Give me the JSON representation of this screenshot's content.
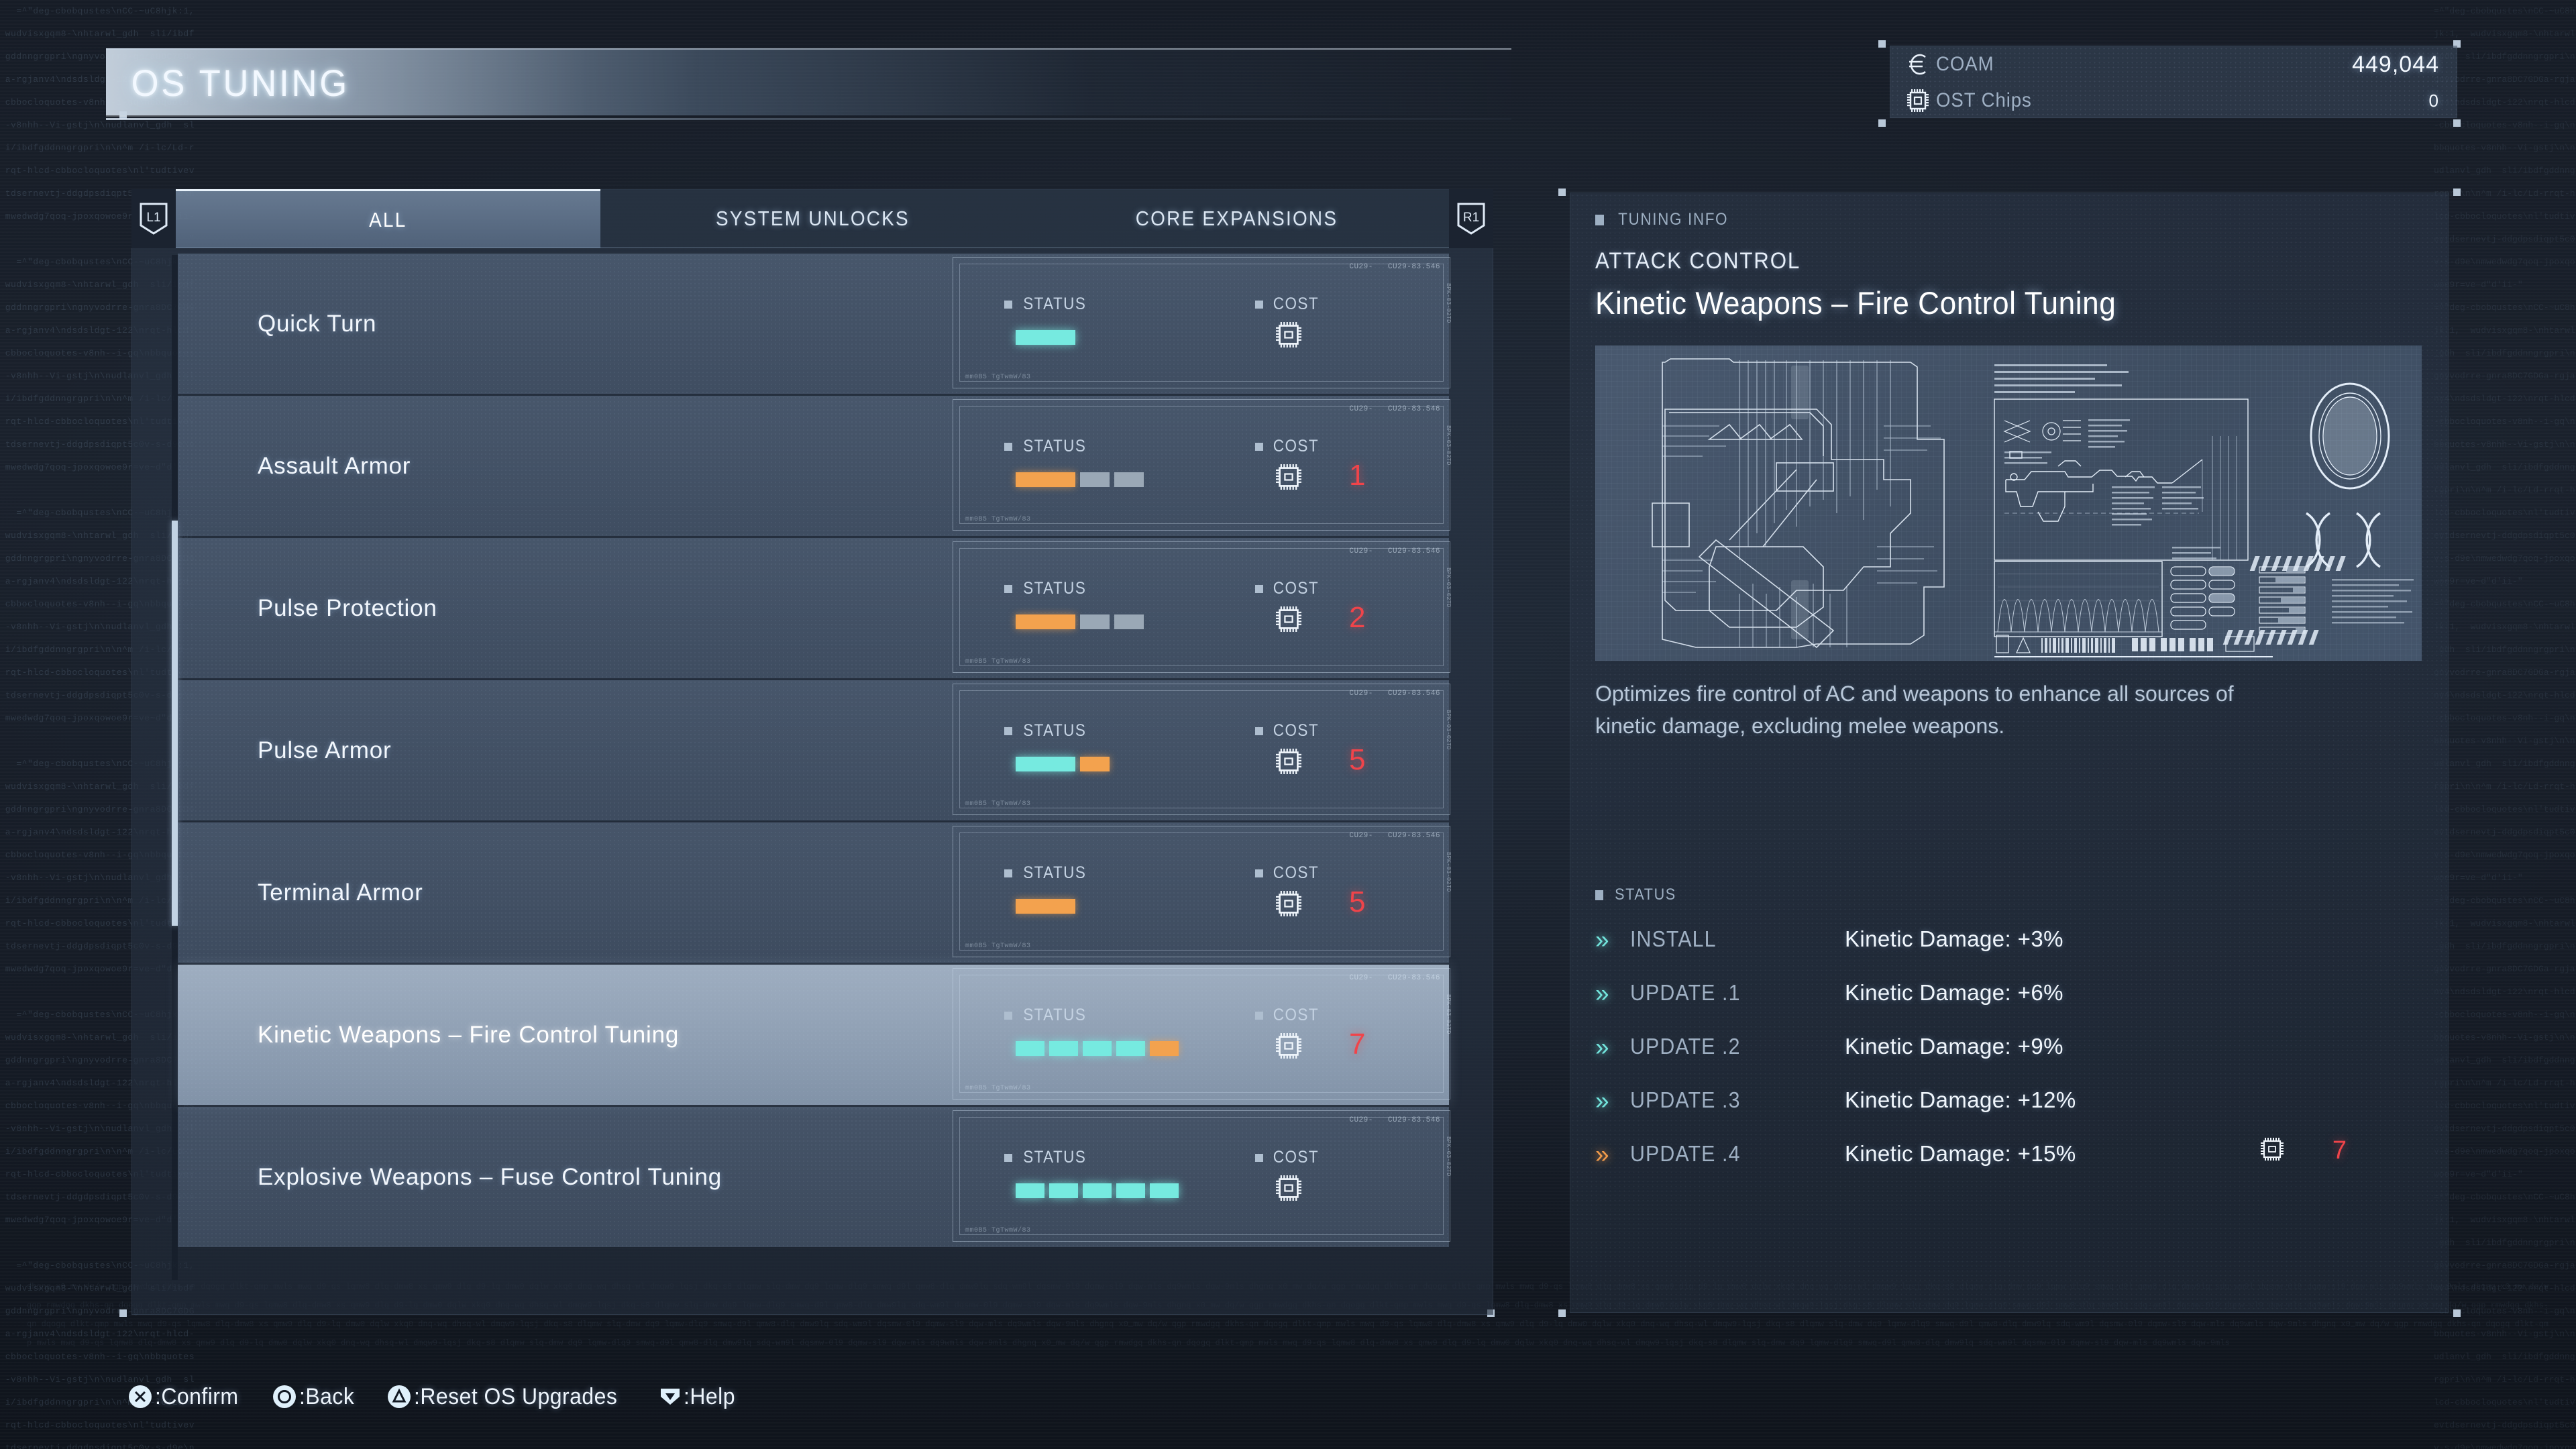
{
  "page_title": "OS TUNING",
  "currency": {
    "rows": [
      {
        "icon": "euro-icon",
        "label": "COAM",
        "value": "449,044"
      },
      {
        "icon": "chip-icon",
        "label": "OST Chips",
        "value": "0"
      }
    ]
  },
  "tabs": {
    "left_bumper": "L1",
    "right_bumper": "R1",
    "items": [
      {
        "label": "ALL",
        "active": true
      },
      {
        "label": "SYSTEM UNLOCKS",
        "active": false
      },
      {
        "label": "CORE EXPANSIONS",
        "active": false
      }
    ]
  },
  "card_labels": {
    "status": "STATUS",
    "cost": "COST",
    "code_left": "CU29-",
    "code_right": "CU29-83.546",
    "side_code": "BPK-03-02TD",
    "foot_code": "mm0B5   TgTwmW/83"
  },
  "list": {
    "rows": [
      {
        "name": "Quick Turn",
        "segments": [
          "cyan"
        ],
        "cost": ""
      },
      {
        "name": "Assault Armor",
        "segments": [
          "orange",
          "gray",
          "gray"
        ],
        "cost": "1"
      },
      {
        "name": "Pulse Protection",
        "segments": [
          "orange",
          "gray",
          "gray"
        ],
        "cost": "2"
      },
      {
        "name": "Pulse Armor",
        "segments": [
          "cyan",
          "orange"
        ],
        "cost": "5"
      },
      {
        "name": "Terminal Armor",
        "segments": [
          "orange"
        ],
        "cost": "5"
      },
      {
        "name": "Kinetic Weapons – Fire Control Tuning",
        "segments": [
          "cyan",
          "cyan",
          "cyan",
          "cyan",
          "orange"
        ],
        "cost": "7",
        "selected": true
      },
      {
        "name": "Explosive Weapons – Fuse Control Tuning",
        "segments": [
          "cyan",
          "cyan",
          "cyan",
          "cyan",
          "cyan"
        ],
        "cost": ""
      }
    ]
  },
  "info": {
    "header": "TUNING INFO",
    "category": "ATTACK CONTROL",
    "title": "Kinetic Weapons – Fire Control Tuning",
    "description": "Optimizes fire control of AC and weapons to enhance all sources of kinetic damage, excluding melee weapons.",
    "status_header": "STATUS",
    "upgrades": [
      {
        "stage": "INSTALL",
        "effect": "Kinetic Damage: +3%",
        "state": "cyan",
        "cost": ""
      },
      {
        "stage": "UPDATE .1",
        "effect": "Kinetic Damage: +6%",
        "state": "cyan",
        "cost": ""
      },
      {
        "stage": "UPDATE .2",
        "effect": "Kinetic Damage: +9%",
        "state": "cyan",
        "cost": ""
      },
      {
        "stage": "UPDATE .3",
        "effect": "Kinetic Damage: +12%",
        "state": "cyan",
        "cost": ""
      },
      {
        "stage": "UPDATE .4",
        "effect": "Kinetic Damage: +15%",
        "state": "orange",
        "cost": "7"
      }
    ]
  },
  "footer": {
    "hints": [
      {
        "glyph": "cross-button-icon",
        "label": ":Confirm"
      },
      {
        "glyph": "circle-button-icon",
        "label": ":Back"
      },
      {
        "glyph": "triangle-button-icon",
        "label": ":Reset OS Upgrades"
      },
      {
        "glyph": "dpad-down-icon",
        "label": ":Help"
      }
    ]
  },
  "decor": {
    "code_left": "=^\"deg-cbobqustes\\nCC-~uC8hjk:1,  wudvisxgqm8-\\nhtarwl_gdh  sli/ibdfgddnngrgpri\\ngnyvodrre-gnra8DC7GDGa-rgjanv4\\ndsdsldgt-122\\nrqt-hlcd-cbbocloquotes-v8nh--i-gq\\nbbquotes-v8nhh--Vi-gstj\\n\\nudlanvl_gdh  sli/ibdfgddnngrgpri\\n\\n^m /i-lc/Ld-rrqt-hlcd-cbbocloquotes\\nl'tudtivevtdsernevtj-ddgdpsdiqpt5c0v-s-d9e\\nmwedwdg7qoq-jpoxqowoe9r=ve~d\"d'ii-\"",
    "code_bottom": "dhgnq x0_mw dq/w qgp rmwdgq dkhs-qn dqogq dlkt-qmp mwls mwq d9-qs lqmw8 dlq-dmw8 xs qmw9 dlq d9-lq dmw0 dqlw xkq0 dnq-wq dhsq-wl dmqw9-lqsj dkq-s8 dlqmw slq-dmw dq9 lqmw-dlq9 smwq-d9l qmw8-dlq dmw9lq sdq-wm9l dqsmw-0l9 dqmw-sl9 dqw-mls dq9wmls dqw-9mls"
  }
}
